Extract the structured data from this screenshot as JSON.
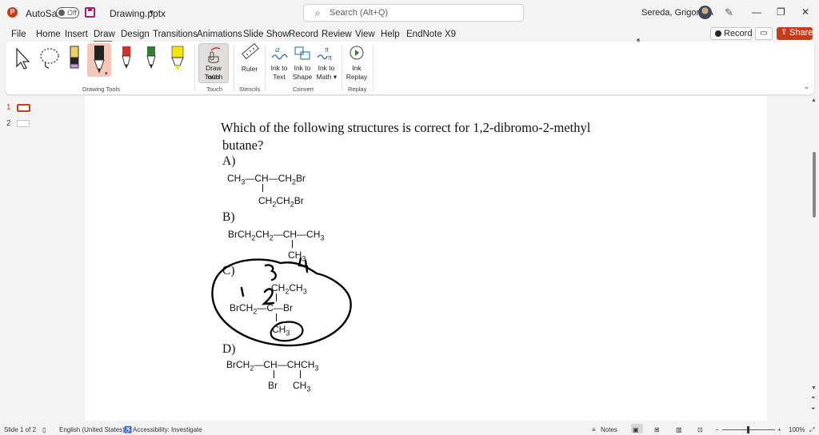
{
  "titlebar": {
    "autosave_label": "AutoSave",
    "autosave_state": "Off",
    "filename": "Drawing.pptx",
    "search_placeholder": "Search (Alt+Q)",
    "user_name": "Sereda, Grigoriy A"
  },
  "menu": {
    "tabs": [
      "File",
      "Home",
      "Insert",
      "Draw",
      "Design",
      "Transitions",
      "Animations",
      "Slide Show",
      "Record",
      "Review",
      "View",
      "Help",
      "EndNote X9"
    ],
    "active_tab": "Draw",
    "record_label": "Record",
    "share_label": "Share"
  },
  "ribbon": {
    "groups": {
      "drawing_tools": "Drawing Tools",
      "touch": "Touch",
      "stencils": "Stencils",
      "convert": "Convert",
      "replay": "Replay"
    },
    "draw_with_touch": [
      "Draw with",
      "Touch"
    ],
    "ruler": "Ruler",
    "ink_to_text": [
      "Ink to",
      "Text"
    ],
    "ink_to_shape": [
      "Ink to",
      "Shape"
    ],
    "ink_to_math": [
      "Ink to",
      "Math"
    ],
    "ink_replay": [
      "Ink",
      "Replay"
    ],
    "pen_colors": [
      "#222222",
      "#d32f2f",
      "#2e7d32",
      "#f5e400"
    ]
  },
  "thumbnails": {
    "slides": [
      "1",
      "2"
    ],
    "active": "1"
  },
  "slide": {
    "question_line1": "Which of the following structures is correct for 1,2-dibromo-2-methyl",
    "question_line2": "butane?",
    "optA": {
      "label": "A)",
      "row1": "CH3—CH—CH2Br",
      "row2": "CH2CH2Br"
    },
    "optB": {
      "label": "B)",
      "row1": "BrCH2CH2—CH—CH3",
      "row2": "CH3"
    },
    "optC": {
      "label": "C)",
      "row1": "CH2CH3",
      "row2": "BrCH2—C—Br",
      "row3": "CH3"
    },
    "optD": {
      "label": "D)",
      "row1": "BrCH2—CH—CHCH3",
      "row2a": "Br",
      "row2b": "CH3"
    },
    "ink_annotations": [
      "1",
      "2",
      "3",
      "4"
    ]
  },
  "statusbar": {
    "slide_info": "Slide 1 of 2",
    "language": "English (United States)",
    "accessibility": "Accessibility: Investigate",
    "notes": "Notes",
    "zoom": "100%"
  }
}
